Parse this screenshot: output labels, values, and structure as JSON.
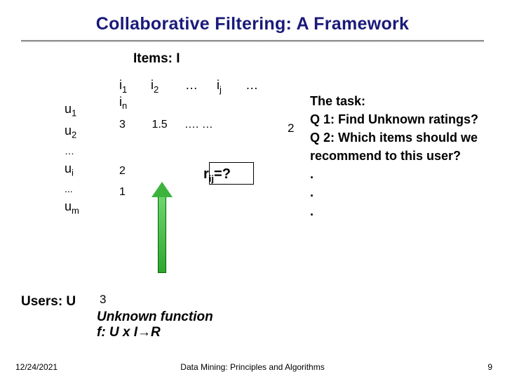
{
  "title": "Collaborative Filtering: A Framework",
  "items_label": "Items: I",
  "users_label": "Users: U",
  "col_heads": {
    "i1": "i",
    "i1s": "1",
    "i2": "i",
    "i2s": "2",
    "dots1": "…",
    "ij": "i",
    "ijs": "j",
    "dots2": "…",
    "in": "i",
    "ins": "n"
  },
  "rows": {
    "u1": "u",
    "u1s": "1",
    "u2": "u",
    "u2s": "2",
    "gap1": "…",
    "ui": "u",
    "uis": "i",
    "gap2": "...",
    "um": "u",
    "ums": "m"
  },
  "grid": {
    "r1c1": "3",
    "r1c2": "1.5",
    "r1c3": "…. …",
    "r2c1": "2",
    "r3c1": "1"
  },
  "stray_two": "2",
  "rij": {
    "r": "r",
    "sub": "ij",
    "eq": "=?"
  },
  "three_below": "3",
  "fn_line1": "Unknown function",
  "fn_line2": "f: U x I→R",
  "task": {
    "heading": "The task:",
    "q1": "Q 1: Find Unknown ratings?",
    "q2": "Q 2: Which items should we recommend to this user?",
    "d1": ".",
    "d2": ".",
    "d3": "."
  },
  "footer": {
    "date": "12/24/2021",
    "center": "Data Mining: Principles and Algorithms",
    "page": "9"
  }
}
